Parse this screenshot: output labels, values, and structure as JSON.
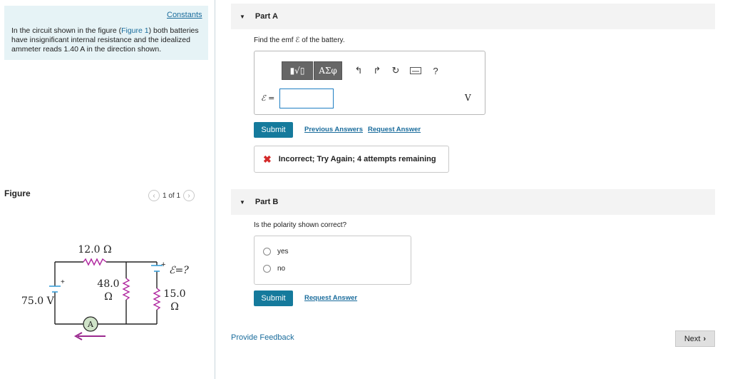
{
  "problem": {
    "constants_link": "Constants",
    "text_before": "In the circuit shown in the figure (",
    "figure_link": "Figure 1",
    "text_after": ") both batteries have insignificant internal resistance and the idealized ammeter reads 1.40 A in the direction shown."
  },
  "figure": {
    "label": "Figure",
    "pager": "1 of 1",
    "prev_icon": "chevron-left-icon",
    "next_icon": "chevron-right-icon",
    "labels": {
      "r1": "12.0 Ω",
      "r2_value": "48.0",
      "r2_unit": "Ω",
      "r3_value": "15.0",
      "r3_unit": "Ω",
      "v1": "75.0 V",
      "emf": "ℰ=?",
      "plus_left": "+",
      "plus_right": "+",
      "ammeter": "A"
    }
  },
  "partA": {
    "title": "Part A",
    "prompt": "Find the emf ℰ of the battery.",
    "toolbar": {
      "templates": "▮√▯",
      "symbols": "ΑΣφ",
      "undo_icon": "undo-icon",
      "redo_icon": "redo-icon",
      "reset_icon": "reset-icon",
      "keyboard_icon": "keyboard-icon",
      "help": "?"
    },
    "equation_label": "ℰ =",
    "input_value": "",
    "unit": "V",
    "submit": "Submit",
    "previous_answers": "Previous Answers",
    "request_answer": "Request Answer",
    "feedback": "Incorrect; Try Again; 4 attempts remaining"
  },
  "partB": {
    "title": "Part B",
    "prompt": "Is the polarity shown correct?",
    "options": [
      "yes",
      "no"
    ],
    "submit": "Submit",
    "request_answer": "Request Answer"
  },
  "footer": {
    "provide_feedback": "Provide Feedback",
    "next": "Next"
  },
  "colors": {
    "accent": "#157a9c",
    "link": "#1a6c9c",
    "error": "#d42a2a",
    "resistor": "#b0279f",
    "arrow": "#9b2a8f",
    "battery": "#3a9fd8"
  }
}
